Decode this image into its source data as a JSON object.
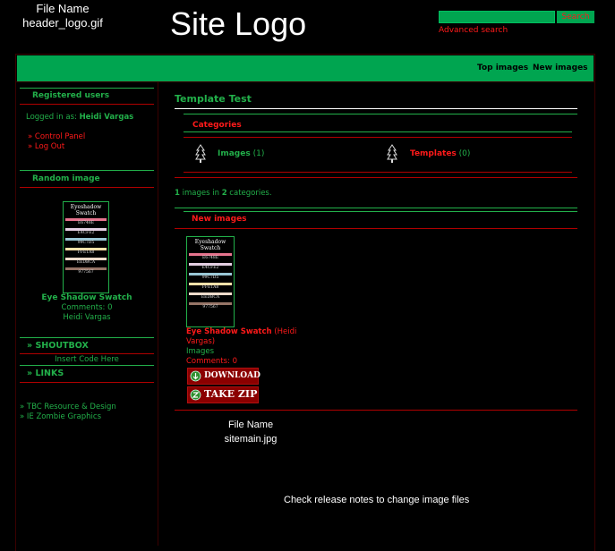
{
  "header": {
    "file_label": "File Name",
    "file_value": "header_logo.gif",
    "logo": "Site Logo",
    "search_button": "Search",
    "advanced_search": "Advanced search"
  },
  "nav": {
    "top_images": "Top images",
    "new_images": "New images"
  },
  "sidebar": {
    "registered_title": "Registered users",
    "logged_in_prefix": "Logged in as:",
    "user_name": "Heidi Vargas",
    "links": [
      "» Control Panel",
      "» Log Out"
    ],
    "random_title": "Random image",
    "random_image": {
      "title": "Eye Shadow Swatch",
      "comments": "Comments: 0",
      "author": "Heidi Vargas"
    },
    "shoutbox_title": "» SHOUTBOX",
    "insert_code": "Insert Code Here",
    "links_title": "» LINKS",
    "link_items": [
      "» TBC Resource & Design",
      "» IE Zombie Graphics"
    ]
  },
  "swatch": {
    "caption": "Eyeshadow Swatch",
    "labels": [
      "E6748E",
      "E4CFE2",
      "99C7D5",
      "FFE1A8",
      "EEDBCA",
      "977567"
    ],
    "colors": [
      "#e6748e",
      "#e4cfe2",
      "#99c7d5",
      "#ffe1a8",
      "#eedbca",
      "#977567"
    ]
  },
  "main": {
    "title": "Template Test",
    "categories_title": "Categories",
    "categories": [
      {
        "name": "Images",
        "count": "(1)"
      },
      {
        "name": "Templates",
        "count": "(0)"
      }
    ],
    "summary": {
      "images": "1",
      "middle": " images in ",
      "cats": "2",
      "end": " categories."
    },
    "new_images_title": "New images",
    "new_image": {
      "title": "Eye Shadow Swatch",
      "author_line1": "(Heidi",
      "author_line2": "Vargas)",
      "category": "Images",
      "comments": "Comments: 0"
    },
    "download_label": "DOWNLOAD",
    "zip_label": "TAKE ZIP",
    "file_label": "File Name",
    "file_value": "sitemain.jpg",
    "release_note": "Check release notes to change image files"
  }
}
